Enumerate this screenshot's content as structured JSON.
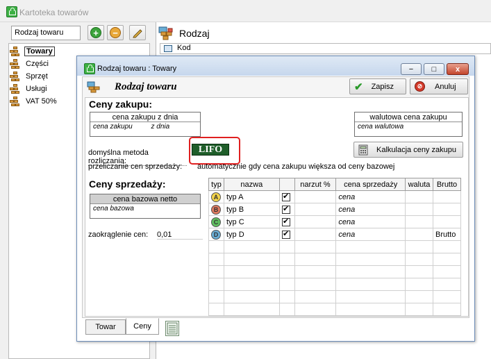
{
  "window": {
    "title": "Kartoteka towarów"
  },
  "left": {
    "dropdown_value": "Rodzaj towaru",
    "tree": [
      "Towary",
      "Części",
      "Sprzęt",
      "Usługi",
      "VAT 50%"
    ]
  },
  "right": {
    "title": "Rodzaj",
    "col_header": "Kod"
  },
  "dialog": {
    "title": "Rodzaj towaru : Towary",
    "minimize": "−",
    "maximize": "□",
    "close": "x",
    "heading": "Rodzaj towaru",
    "save_label": "Zapisz",
    "cancel_label": "Anuluj",
    "purchase": {
      "section_title": "Ceny zakupu:",
      "date_box_title": "cena zakupu z dnia",
      "date_box_v1": "cena zakupu",
      "date_box_v2": "z dnia",
      "currency_box_title": "walutowa cena zakupu",
      "currency_box_value": "cena walutowa",
      "calc_button": "Kalkulacja ceny zakupu",
      "method_label": "domyślna metoda rozliczania:",
      "method_value": "LIFO",
      "recalc_label": "przeliczanie cen sprzedaży:",
      "recalc_value": "automatycznie gdy cena zakupu większa od ceny bazowej"
    },
    "sales": {
      "section_title": "Ceny sprzedaży:",
      "base_box_title": "cena bazowa netto",
      "base_box_value": "cena bazowa",
      "rounding_label": "zaokrąglenie cen:",
      "rounding_value": "0,01",
      "table": {
        "headers": [
          "typ",
          "nazwa",
          "",
          "narzut %",
          "cena sprzedaży",
          "waluta",
          "Brutto"
        ],
        "rows": [
          {
            "typ": "A",
            "nazwa": "typ A",
            "checked": "✔",
            "narzut": "",
            "cena": "cena",
            "waluta": "",
            "brutto": ""
          },
          {
            "typ": "B",
            "nazwa": "typ B",
            "checked": "✔",
            "narzut": "",
            "cena": "cena",
            "waluta": "",
            "brutto": ""
          },
          {
            "typ": "C",
            "nazwa": "typ C",
            "checked": "✔",
            "narzut": "",
            "cena": "cena",
            "waluta": "",
            "brutto": ""
          },
          {
            "typ": "D",
            "nazwa": "typ D",
            "checked": "✔",
            "narzut": "",
            "cena": "cena",
            "waluta": "",
            "brutto": "Brutto"
          }
        ],
        "type_colors": {
          "A": "#f2d34a",
          "B": "#e07a5f",
          "C": "#5fbf5f",
          "D": "#6aaed6"
        }
      }
    },
    "tabs": [
      "Towar",
      "Ceny"
    ]
  },
  "icons": {
    "add": "plus-icon",
    "remove": "minus-icon",
    "edit": "pencil-icon",
    "save": "checkmark-icon",
    "cancel": "cancel-icon",
    "calc": "calculator-icon",
    "notes": "notepad-icon"
  }
}
